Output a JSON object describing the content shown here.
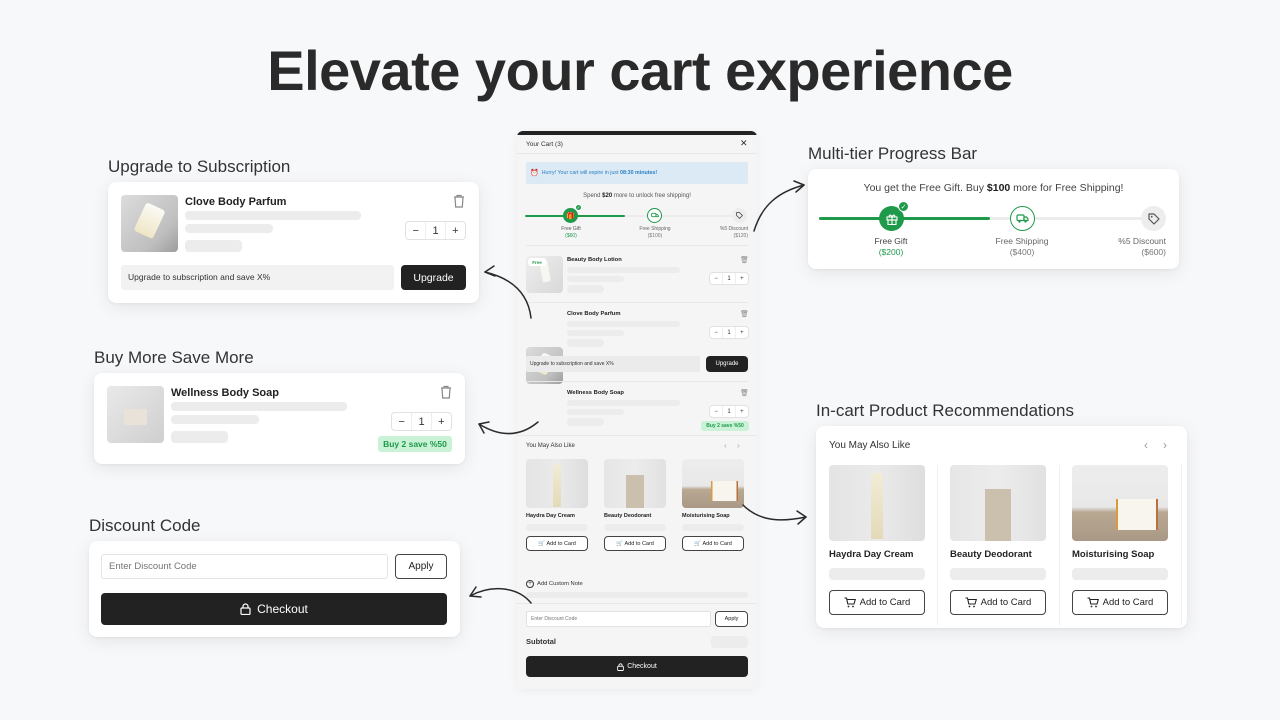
{
  "hero": {
    "title": "Elevate your cart experience"
  },
  "sections": {
    "subscription": {
      "label": "Upgrade to Subscription",
      "product_name": "Clove Body Parfum",
      "quantity": "1",
      "upgrade_text": "Upgrade to subscription and save X%",
      "upgrade_button": "Upgrade"
    },
    "bmsm": {
      "label": "Buy More Save More",
      "product_name": "Wellness Body Soap",
      "quantity": "1",
      "badge": "Buy 2 save %50"
    },
    "discount": {
      "label": "Discount Code",
      "input_placeholder": "Enter Discount Code",
      "apply_button": "Apply",
      "checkout_button": "Checkout"
    },
    "progress": {
      "label": "Multi-tier Progress Bar",
      "message_prefix": "You get the Free Gift. Buy ",
      "message_amount": "$100",
      "message_suffix": " more for Free Shipping!",
      "progress_percent": 50,
      "tiers": [
        {
          "name": "Free Gift",
          "price": "($200)",
          "icon": "gift-icon",
          "state": "done"
        },
        {
          "name": "Free Shipping",
          "price": "($400)",
          "icon": "truck-icon",
          "state": "next"
        },
        {
          "name": "%5 Discount",
          "price": "($600)",
          "icon": "tag-icon",
          "state": "locked"
        }
      ]
    },
    "recommendations": {
      "label": "In-cart Product Recommendations",
      "title": "You May Also Like",
      "items": [
        {
          "name": "Haydra Day Cream",
          "button": "Add to Card"
        },
        {
          "name": "Beauty Deodorant",
          "button": "Add to Card"
        },
        {
          "name": "Moisturising Soap",
          "button": "Add to Card"
        }
      ]
    }
  },
  "cart": {
    "title": "Your Cart (3)",
    "timer_prefix": "Hurry! Your cart will expire in just ",
    "timer_value": "08:30 minutes!",
    "spend_prefix": "Spend ",
    "spend_amount": "$20",
    "spend_suffix": " more to unlock free shipping!",
    "progress_percent": 45,
    "tiers": [
      {
        "name": "Free Gift",
        "price": "($60)",
        "state": "done"
      },
      {
        "name": "Free Shipping",
        "price": "($100)",
        "state": "next"
      },
      {
        "name": "%5 Discount",
        "price": "($120)",
        "state": "locked"
      }
    ],
    "items": [
      {
        "name": "Beauty Body Lotion",
        "quantity": "1",
        "badge": "Free"
      },
      {
        "name": "Clove Body Parfum",
        "quantity": "1"
      },
      {
        "name": "Wellness Body Soap",
        "quantity": "1",
        "badge": "Buy 2 save %50"
      }
    ],
    "upgrade_text": "Upgrade to subscription and save X%",
    "upgrade_button": "Upgrade",
    "recommend_title": "You May Also Like",
    "recommendations": [
      {
        "name": "Haydra Day Cream",
        "button": "Add to Card"
      },
      {
        "name": "Beauty Deodorant",
        "button": "Add to Card"
      },
      {
        "name": "Moisturising Soap",
        "button": "Add to Card"
      }
    ],
    "custom_note": "Add Custom Note",
    "discount_placeholder": "Enter Discount Code",
    "apply_button": "Apply",
    "subtotal_label": "Subtotal",
    "checkout_button": "Checkout"
  },
  "colors": {
    "accent_green": "#1f9a4a",
    "dark": "#222222",
    "timer_bg": "#dbeaf5",
    "timer_text": "#2a7fc4"
  }
}
